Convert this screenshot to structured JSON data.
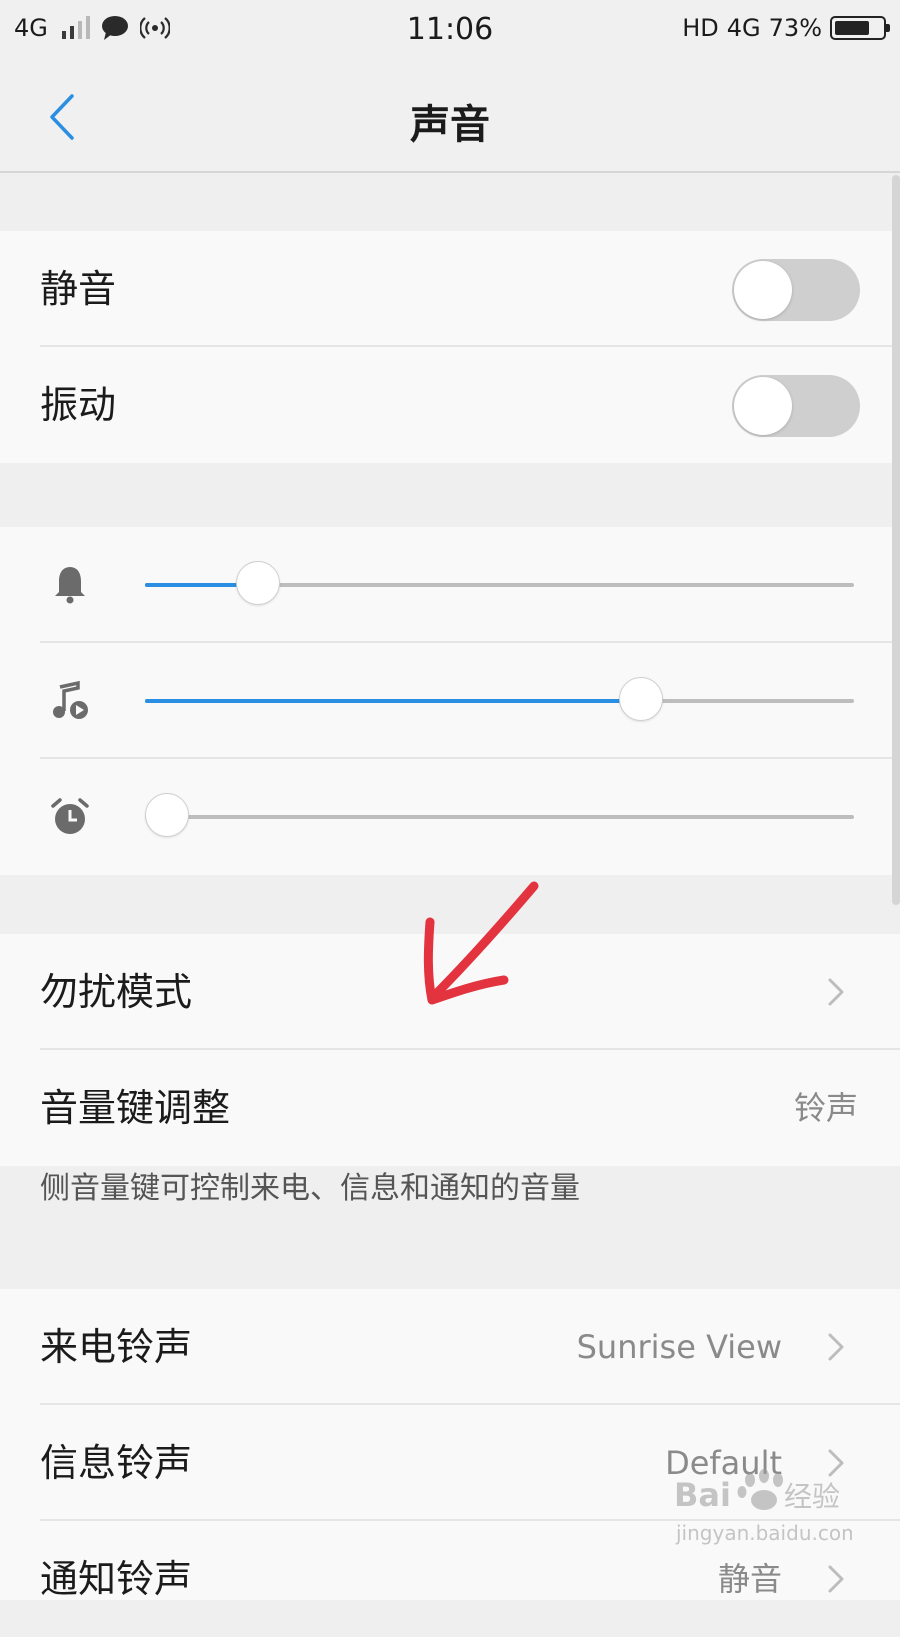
{
  "status_bar": {
    "network": "4G",
    "time": "11:06",
    "hd": "HD",
    "network_right": "4G",
    "battery_text": "73%",
    "battery_level": 0.73
  },
  "nav": {
    "title": "声音"
  },
  "toggles": {
    "mute": {
      "label": "静音",
      "on": false
    },
    "vibrate": {
      "label": "振动",
      "on": false
    }
  },
  "volume": {
    "ringtone_level": 0.16,
    "media_level": 0.7,
    "alarm_level": 0.0,
    "accent_color": "#2a8ee3",
    "icons": [
      "bell-icon",
      "music-icon",
      "alarm-clock-icon"
    ]
  },
  "dnd": {
    "label": "勿扰模式"
  },
  "volume_key": {
    "label": "音量键调整",
    "value": "铃声",
    "caption": "侧音量键可控制来电、信息和通知的音量"
  },
  "ringtones": {
    "incoming": {
      "label": "来电铃声",
      "value": "Sunrise View"
    },
    "message": {
      "label": "信息铃声",
      "value": "Default"
    },
    "notification": {
      "label": "通知铃声",
      "value": "静音"
    }
  },
  "watermark": {
    "brand": "Bai",
    "brand_cn": "经验",
    "url": "jingyan.baidu.com"
  }
}
